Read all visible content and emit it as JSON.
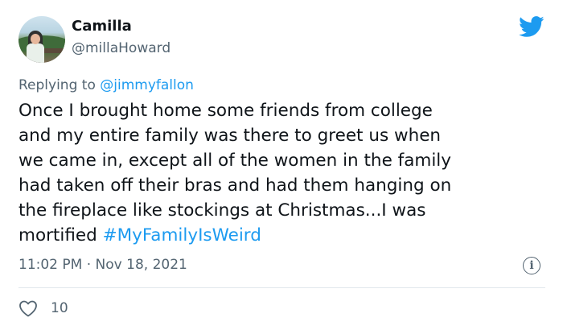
{
  "user": {
    "display_name": "Camilla",
    "handle": "@millaHoward"
  },
  "reply": {
    "prefix": "Replying to ",
    "mention": "@jimmyfallon"
  },
  "tweet": {
    "lines": [
      "Once I brought home some friends from college",
      "and my entire family was there to greet us when",
      "we came in, except all of the women in the family",
      "had taken off their bras and had them hanging on",
      "the fireplace like stockings at Christmas...I was",
      "mortified "
    ],
    "hashtag": "#MyFamilyIsWeird"
  },
  "meta": {
    "time": "11:02 PM",
    "separator": " · ",
    "date": "Nov 18, 2021"
  },
  "stats": {
    "likes": "10"
  },
  "icons": {
    "brand": "twitter-bird-icon",
    "info": "info-icon",
    "like": "heart-icon"
  },
  "colors": {
    "link": "#1d9bf0",
    "secondary_text": "#536471",
    "primary_text": "#0f1419"
  }
}
